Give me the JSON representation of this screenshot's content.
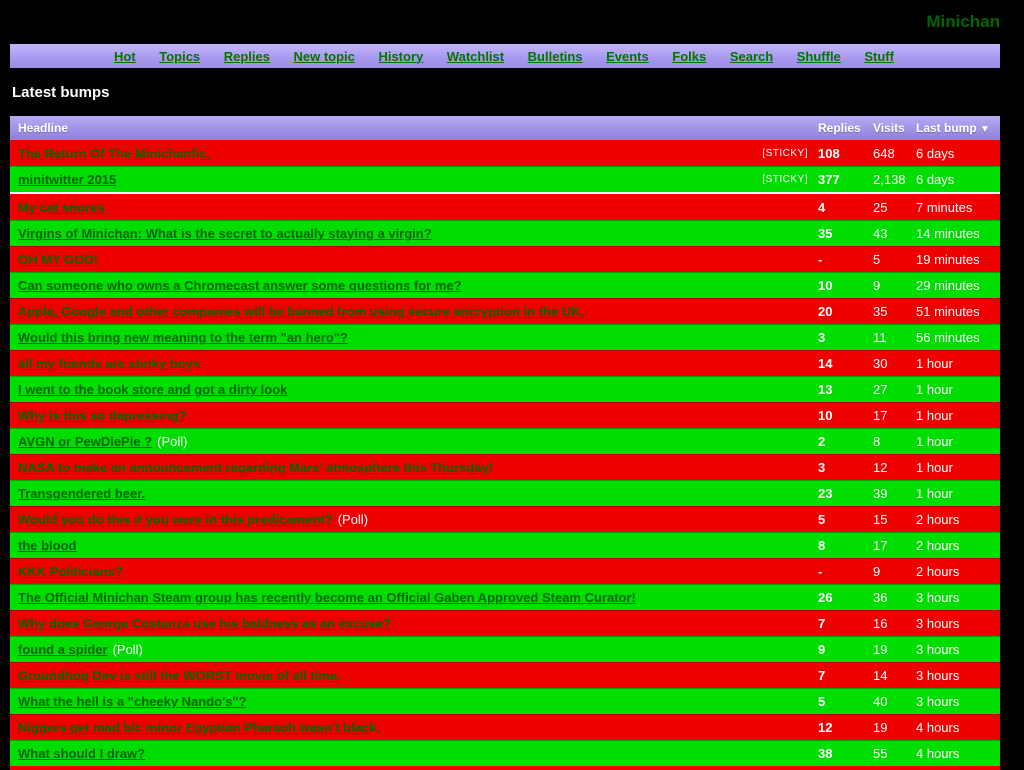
{
  "site": {
    "title": "Minichan"
  },
  "nav": {
    "items": [
      "Hot",
      "Topics",
      "Replies",
      "New topic",
      "History",
      "Watchlist",
      "Bulletins",
      "Events",
      "Folks",
      "Search",
      "Shuffle",
      "Stuff"
    ]
  },
  "heading": "Latest bumps",
  "table": {
    "columns": {
      "headline": "Headline",
      "replies": "Replies",
      "visits": "Visits",
      "last_bump": "Last bump",
      "sort_arrow": "▼"
    },
    "sticky_label": "[STICKY]",
    "poll_label": "(Poll)",
    "rows": [
      {
        "headline": "The Return Of The Minichanfic.",
        "sticky": true,
        "poll": false,
        "replies": "108",
        "visits": "648",
        "last_bump": "6 days",
        "color": "red"
      },
      {
        "headline": "minitwitter 2015",
        "sticky": true,
        "poll": false,
        "replies": "377",
        "visits": "2,138",
        "last_bump": "6 days",
        "color": "green"
      },
      {
        "headline": "My cat snores",
        "sticky": false,
        "poll": false,
        "replies": "4",
        "visits": "25",
        "last_bump": "7 minutes",
        "color": "red"
      },
      {
        "headline": "Virgins of Minichan: What is the secret to actually staying a virgin?",
        "sticky": false,
        "poll": false,
        "replies": "35",
        "visits": "43",
        "last_bump": "14 minutes",
        "color": "green"
      },
      {
        "headline": "OH MY GOD!",
        "sticky": false,
        "poll": false,
        "replies": "-",
        "visits": "5",
        "last_bump": "19 minutes",
        "color": "red"
      },
      {
        "headline": "Can someone who owns a Chromecast answer some questions for me?",
        "sticky": false,
        "poll": false,
        "replies": "10",
        "visits": "9",
        "last_bump": "29 minutes",
        "color": "green"
      },
      {
        "headline": "Apple, Google and other companies will be banned from using secure encryption in the UK.",
        "sticky": false,
        "poll": false,
        "replies": "20",
        "visits": "35",
        "last_bump": "51 minutes",
        "color": "red"
      },
      {
        "headline": "Would this bring new meaning to the term \"an hero\"?",
        "sticky": false,
        "poll": false,
        "replies": "3",
        "visits": "11",
        "last_bump": "56 minutes",
        "color": "green"
      },
      {
        "headline": "all my friends are stinky boys",
        "sticky": false,
        "poll": false,
        "replies": "14",
        "visits": "30",
        "last_bump": "1 hour",
        "color": "red"
      },
      {
        "headline": "I went to the book store and got a dirty look",
        "sticky": false,
        "poll": false,
        "replies": "13",
        "visits": "27",
        "last_bump": "1 hour",
        "color": "green"
      },
      {
        "headline": "Why is this so depressing?",
        "sticky": false,
        "poll": false,
        "replies": "10",
        "visits": "17",
        "last_bump": "1 hour",
        "color": "red"
      },
      {
        "headline": "AVGN or PewDiePie ?",
        "sticky": false,
        "poll": true,
        "replies": "2",
        "visits": "8",
        "last_bump": "1 hour",
        "color": "green"
      },
      {
        "headline": "NASA to make an announcement regarding Mars' atmosphere this Thursday!",
        "sticky": false,
        "poll": false,
        "replies": "3",
        "visits": "12",
        "last_bump": "1 hour",
        "color": "red"
      },
      {
        "headline": "Transgendered beer.",
        "sticky": false,
        "poll": false,
        "replies": "23",
        "visits": "39",
        "last_bump": "1 hour",
        "color": "green"
      },
      {
        "headline": "Would you do this if you were in this predicament?",
        "sticky": false,
        "poll": true,
        "replies": "5",
        "visits": "15",
        "last_bump": "2 hours",
        "color": "red"
      },
      {
        "headline": "the blood",
        "sticky": false,
        "poll": false,
        "replies": "8",
        "visits": "17",
        "last_bump": "2 hours",
        "color": "green"
      },
      {
        "headline": "KKK Politicians?",
        "sticky": false,
        "poll": false,
        "replies": "-",
        "visits": "9",
        "last_bump": "2 hours",
        "color": "red"
      },
      {
        "headline": "The Official Minichan Steam group has recently become an Official Gaben Approved Steam Curator!",
        "sticky": false,
        "poll": false,
        "replies": "26",
        "visits": "36",
        "last_bump": "3 hours",
        "color": "green"
      },
      {
        "headline": "Why does George Costanza use his baldness as an excuse?",
        "sticky": false,
        "poll": false,
        "replies": "7",
        "visits": "16",
        "last_bump": "3 hours",
        "color": "red"
      },
      {
        "headline": "found a spider",
        "sticky": false,
        "poll": true,
        "replies": "9",
        "visits": "19",
        "last_bump": "3 hours",
        "color": "green"
      },
      {
        "headline": "Groundhog Day is still the WORST movie of all time.",
        "sticky": false,
        "poll": false,
        "replies": "7",
        "visits": "14",
        "last_bump": "3 hours",
        "color": "red"
      },
      {
        "headline": "What the hell is a \"cheeky Nando's\"?",
        "sticky": false,
        "poll": false,
        "replies": "5",
        "visits": "40",
        "last_bump": "3 hours",
        "color": "green"
      },
      {
        "headline": "Niggers get mad b/c minor Egyptian Pharaoh wasn't black.",
        "sticky": false,
        "poll": false,
        "replies": "12",
        "visits": "19",
        "last_bump": "4 hours",
        "color": "red"
      },
      {
        "headline": "What should I draw?",
        "sticky": false,
        "poll": false,
        "replies": "38",
        "visits": "55",
        "last_bump": "4 hours",
        "color": "green"
      }
    ]
  },
  "colors": {
    "background": "#000000",
    "row_red": "#ee0000",
    "row_green": "#00dd00",
    "link_green": "#006600",
    "nav_link_green": "#007700",
    "nav_gradient_top": "#c3b5fa",
    "nav_gradient_bottom": "#9b8be4",
    "header_gradient_top": "#b7aaf2",
    "header_gradient_bottom": "#8f81dc",
    "text_white": "#ffffff"
  }
}
